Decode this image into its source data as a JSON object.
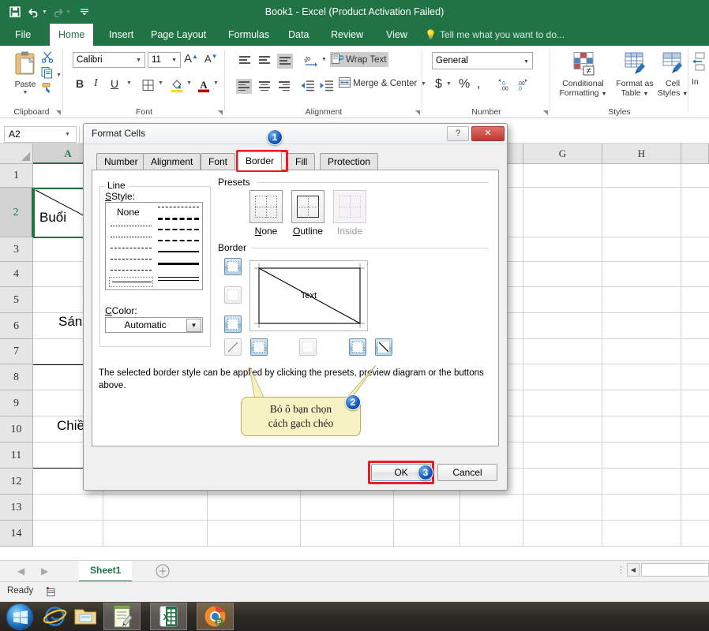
{
  "titlebar": {
    "title": "Book1 - Excel (Product Activation Failed)",
    "qat": [
      {
        "name": "save-icon",
        "glyph": "὚B"
      },
      {
        "name": "undo-icon",
        "glyph": "↶"
      },
      {
        "name": "redo-icon",
        "glyph": "↷"
      },
      {
        "name": "customize-qat-icon",
        "glyph": "⤓"
      }
    ]
  },
  "ribbon": {
    "tabs": [
      {
        "label": "File",
        "active": false
      },
      {
        "label": "Home",
        "active": true
      },
      {
        "label": "Insert",
        "active": false
      },
      {
        "label": "Page Layout",
        "active": false
      },
      {
        "label": "Formulas",
        "active": false
      },
      {
        "label": "Data",
        "active": false
      },
      {
        "label": "Review",
        "active": false
      },
      {
        "label": "View",
        "active": false
      }
    ],
    "tellme": "Tell me what you want to do...",
    "groups": {
      "clipboard": {
        "label": "Clipboard",
        "paste": "Paste",
        "cut_icon": "scissors-icon",
        "copy_icon": "copy-icon",
        "format_painter_icon": "format-painter-icon"
      },
      "font": {
        "label": "Font",
        "font_name": "Calibri",
        "font_size": "11",
        "grow_font": "A",
        "shrink_font": "A",
        "bold": "B",
        "italic": "I",
        "underline": "U"
      },
      "alignment": {
        "label": "Alignment",
        "wrap_text": "Wrap Text",
        "merge_center": "Merge & Center"
      },
      "number": {
        "label": "Number",
        "format": "General",
        "currency": "$",
        "percent": "%",
        "comma": ","
      },
      "styles": {
        "label": "Styles",
        "conditional_formatting": "Conditional\nFormatting",
        "conditional_formatting_l1": "Conditional",
        "conditional_formatting_l2": "Formatting",
        "format_as_table_l1": "Format as",
        "format_as_table_l2": "Table",
        "cell_styles_l1": "Cell",
        "cell_styles_l2": "Styles"
      },
      "cells": {
        "label": "In",
        "insert": "In"
      }
    }
  },
  "formula_bar": {
    "name_box": "A2",
    "formula": ""
  },
  "grid": {
    "columns": [
      "A",
      "G",
      "H"
    ],
    "column_headers_visible": [
      "A",
      "G",
      "H"
    ],
    "rows": [
      "1",
      "2",
      "3",
      "4",
      "5",
      "6",
      "7",
      "8",
      "9",
      "10",
      "11",
      "12",
      "13",
      "14"
    ],
    "selected_cell": "A2",
    "cells": [
      {
        "ref": "A2",
        "value": "Buổi"
      },
      {
        "ref": "A5",
        "value": "Sáng"
      },
      {
        "ref": "A9",
        "value": "Chiều"
      }
    ]
  },
  "sheet_bar": {
    "sheet_name": "Sheet1",
    "add_sheet_icon": "plus-circle-icon",
    "prev_icon": "◀",
    "next_icon": "▶"
  },
  "status_bar": {
    "status": "Ready",
    "macro_icon": "record-macro-icon"
  },
  "taskbar": {
    "items": [
      {
        "name": "start-orb-icon"
      },
      {
        "name": "internet-explorer-icon"
      },
      {
        "name": "file-explorer-icon"
      },
      {
        "name": "notepad-icon"
      },
      {
        "name": "excel-icon"
      },
      {
        "name": "chrome-icon"
      }
    ]
  },
  "dialog": {
    "title": "Format Cells",
    "help_glyph": "?",
    "close_glyph": "✕",
    "tabs": [
      {
        "label": "Number",
        "active": false
      },
      {
        "label": "Alignment",
        "active": false
      },
      {
        "label": "Font",
        "active": false
      },
      {
        "label": "Border",
        "active": true
      },
      {
        "label": "Fill",
        "active": false
      },
      {
        "label": "Protection",
        "active": false
      }
    ],
    "line": {
      "group_label": "Line",
      "style_label": "Style:",
      "none_label": "None",
      "color_label": "Color:",
      "color_value": "Automatic"
    },
    "presets": {
      "group_label": "Presets",
      "items": [
        {
          "label": "None",
          "disabled": false
        },
        {
          "label": "Outline",
          "disabled": false
        },
        {
          "label": "Inside",
          "disabled": true
        }
      ]
    },
    "border": {
      "group_label": "Border",
      "preview_text": "Text",
      "buttons": [
        {
          "name": "border-top-button",
          "active": true
        },
        {
          "name": "border-horizontal-inside-button",
          "active": false
        },
        {
          "name": "border-bottom-button",
          "active": true
        },
        {
          "name": "border-diagonal-up-button",
          "active": false
        },
        {
          "name": "border-left-button",
          "active": true
        },
        {
          "name": "border-vertical-inside-button",
          "active": false
        },
        {
          "name": "border-right-button",
          "active": true
        },
        {
          "name": "border-diagonal-down-button",
          "active": true
        }
      ]
    },
    "help_text": "The selected border style can be applied by clicking the presets, preview diagram or the buttons above.",
    "ok_label": "OK",
    "cancel_label": "Cancel"
  },
  "annotations": {
    "badge1": "1",
    "badge2": "2",
    "badge3": "3",
    "callout_line1": "Bỏ ô bạn chọn",
    "callout_line2": "cách gạch chéo",
    "highlight_color": "#ec1c24",
    "badge_color": "#1656b8"
  },
  "colors": {
    "excel_green": "#217346",
    "ribbon_bg": "#ffffff",
    "grid_line": "#d4d4d4",
    "header_bg": "#e6e6e6"
  }
}
